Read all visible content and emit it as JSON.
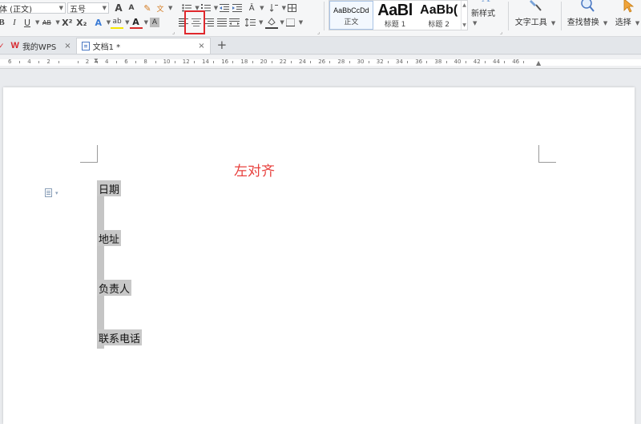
{
  "ribbon": {
    "font_name": "体 (正文)",
    "font_size": "五号",
    "styles": [
      {
        "preview": "AaBbCcDd",
        "label": "正文"
      },
      {
        "preview": "AaBl",
        "label": "标题 1"
      },
      {
        "preview": "AaBb(",
        "label": "标题 2"
      }
    ],
    "new_style_label": "新样式",
    "text_tools_label": "文字工具",
    "find_replace_label": "查找替换",
    "select_label": "选择",
    "icons": {
      "font_grow": "A",
      "font_shrink": "A",
      "bold": "B",
      "italic": "I",
      "underline": "U",
      "strikethrough": "AB",
      "superscript": "X²",
      "subscript": "X₂"
    }
  },
  "tabs": [
    {
      "label": "我的WPS",
      "close": "×"
    },
    {
      "label": "文档1 *",
      "close": "×"
    }
  ],
  "new_tab": "+",
  "ruler": {
    "numbers": [
      "6",
      "4",
      "2",
      "",
      "2",
      "4",
      "6",
      "8",
      "10",
      "12",
      "14",
      "16",
      "18",
      "20",
      "22",
      "24",
      "26",
      "28",
      "30",
      "32",
      "34",
      "36",
      "38",
      "40",
      "42",
      "44",
      "46"
    ]
  },
  "document": {
    "title": "左对齐",
    "title_color": "#e8403d",
    "fields": [
      "日期",
      "地址",
      "负责人",
      "联系电话"
    ]
  },
  "colors": {
    "highlight": "#e0282d",
    "accent": "#4a78c2"
  }
}
